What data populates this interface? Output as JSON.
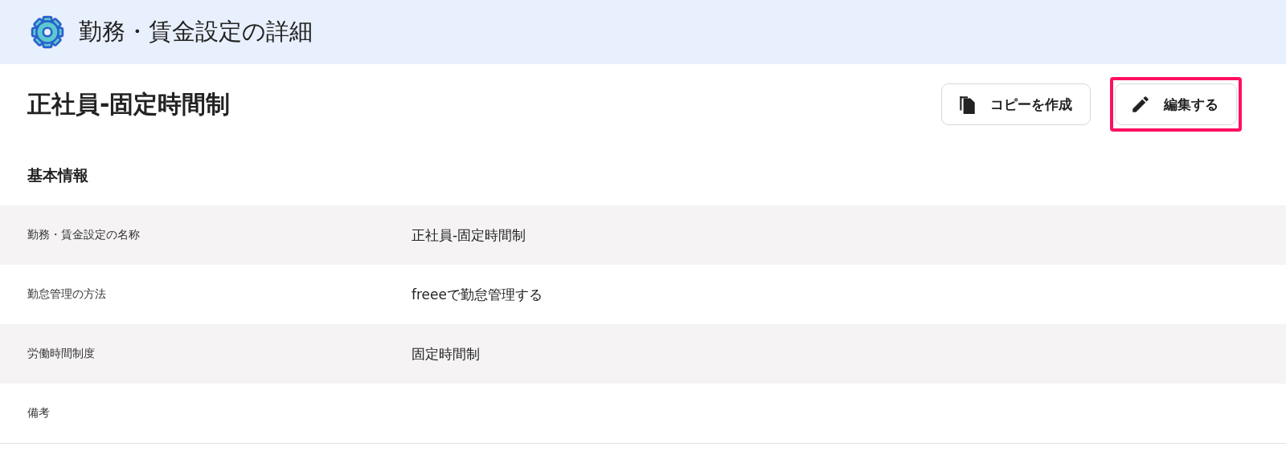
{
  "header": {
    "title": "勤務・賃金設定の詳細"
  },
  "page": {
    "title": "正社員-固定時間制"
  },
  "buttons": [
    {
      "kind": "copy",
      "label": "コピーを作成",
      "highlighted": false
    },
    {
      "kind": "edit",
      "label": "編集する",
      "highlighted": true
    }
  ],
  "section": {
    "title": "基本情報"
  },
  "rows": [
    {
      "label": "勤務・賃金設定の名称",
      "value": "正社員-固定時間制"
    },
    {
      "label": "勤怠管理の方法",
      "value": "freeeで勤怠管理する"
    },
    {
      "label": "労働時間制度",
      "value": "固定時間制"
    },
    {
      "label": "備考"
    }
  ]
}
